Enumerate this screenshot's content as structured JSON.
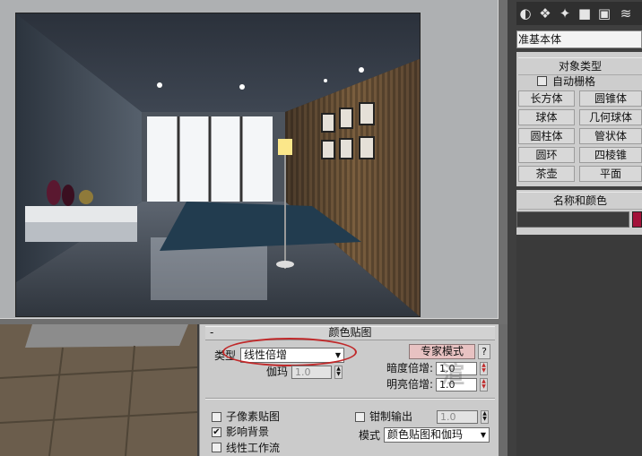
{
  "command_panel": {
    "category": "准基本体",
    "object_type_title": "对象类型",
    "autogrid_label": "自动栅格",
    "autogrid_checked": false,
    "primitives": [
      "长方体",
      "圆锥体",
      "球体",
      "几何球体",
      "圆柱体",
      "管状体",
      "圆环",
      "四棱锥",
      "茶壶",
      "平面"
    ],
    "name_color_title": "名称和颜色",
    "name_value": "",
    "object_color": "#a3123a",
    "toolbar_icons": [
      "create-geometry-icon",
      "shapes-icon",
      "lights-icon",
      "cameras-icon",
      "helpers-icon",
      "space-warps-icon"
    ]
  },
  "color_mapping": {
    "collapse_symbol": "-",
    "title": "颜色贴图",
    "type_label": "类型",
    "type_value": "线性倍增",
    "expert_button": "专家模式",
    "help_button": "?",
    "gamma_label": "伽玛",
    "gamma_value": "1.0",
    "dark_multiplier_label": "暗度倍增:",
    "dark_multiplier_value": "1.0",
    "bright_multiplier_label": "明亮倍增:",
    "bright_multiplier_value": "1.0",
    "subpixel_label": "子像素贴图",
    "subpixel_checked": false,
    "clamp_label": "钳制输出",
    "clamp_checked": false,
    "clamp_value": "1.0",
    "affect_bg_label": "影响背景",
    "affect_bg_checked": true,
    "linear_workflow_label": "线性工作流",
    "linear_workflow_checked": false,
    "mode_label": "模式",
    "mode_value": "颜色贴图和伽玛",
    "highlight_color": "#c0292a"
  },
  "watermark": "渲"
}
